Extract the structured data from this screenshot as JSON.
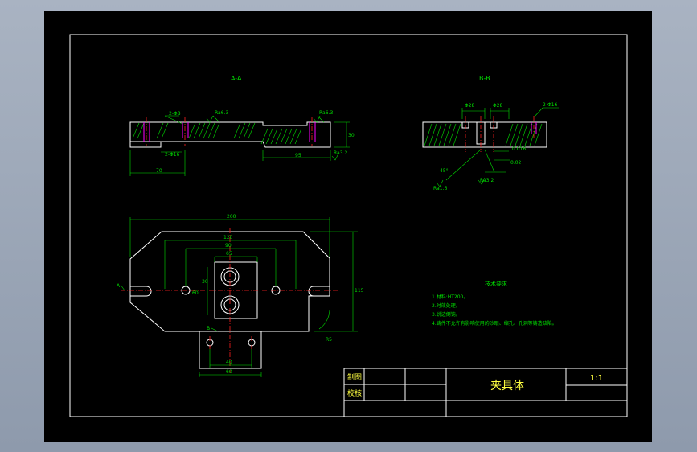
{
  "drawing": {
    "section_a_label": "A-A",
    "section_b_label": "B-B",
    "title": "夹具体",
    "scale": "1:1",
    "designer_label": "制图",
    "checker_label": "校核"
  },
  "tech_req": {
    "heading": "技术要求",
    "items": [
      "1.材料:HT200。",
      "2.时效处理。",
      "3.锐边倒钝。",
      "4.铸件不允许有影响使用的砂眼、缩孔、孔洞等铸造缺陷。"
    ]
  },
  "dims": {
    "aa_hole_note_left": "2-Φ8",
    "aa_ra_left": "Ra6.3",
    "aa_ra_right": "Ra6.3",
    "aa_bottom_left": "2-Φ16",
    "aa_len_left": "70",
    "aa_len_right": "95",
    "aa_height": "30",
    "aa_ra_bottom": "Ra3.2",
    "bb_d1": "Φ28",
    "bb_d2": "Φ28",
    "bb_hole_note": "2-Φ16",
    "bb_tol1": "0.016",
    "bb_tol2": "0.02",
    "bb_ra1": "Ra1.6",
    "bb_ra2": "Ra3.2",
    "bb_angle": "45°",
    "plan_total": "200",
    "plan_120": "120",
    "plan_90": "90",
    "plan_65": "65",
    "plan_h": "115",
    "plan_v60": "60",
    "plan_v30": "30",
    "plan_40": "40",
    "plan_60": "60",
    "plan_r": "R5",
    "plan_b": "B",
    "plan_a": "A"
  },
  "colors": {
    "outline": "#ffffff",
    "dimension": "#00e000",
    "center": "#ff2020",
    "hatch": "#00e000",
    "hidden": "#ff00ff"
  }
}
